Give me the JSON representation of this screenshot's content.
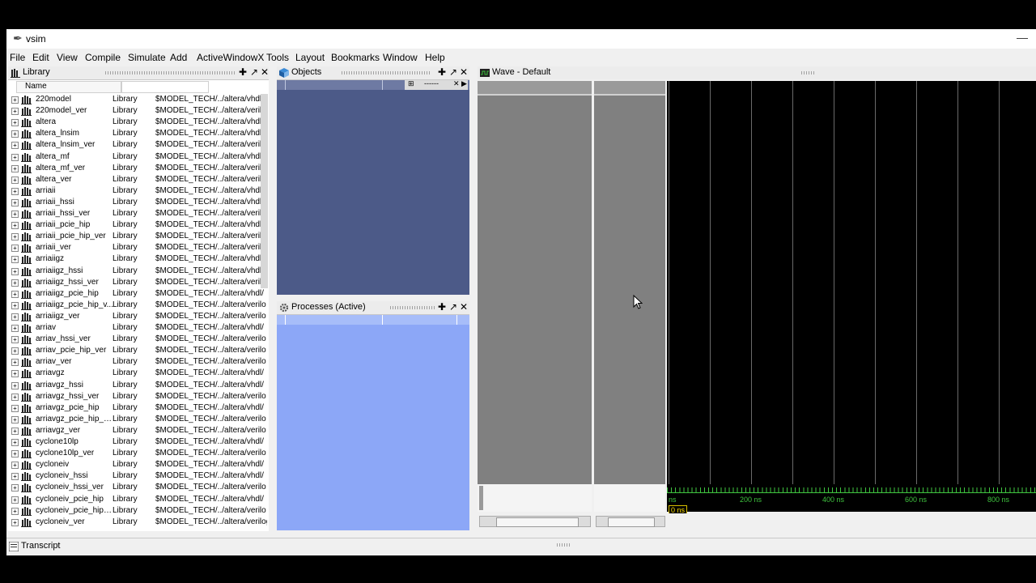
{
  "window": {
    "title": "vsim"
  },
  "menu": [
    "File",
    "Edit",
    "View",
    "Compile",
    "Simulate",
    "Add",
    "ActiveWindowX",
    "Tools",
    "Layout",
    "Bookmarks",
    "Window",
    "Help"
  ],
  "library": {
    "title": "Library",
    "column_name": "Name",
    "rows": [
      {
        "name": "220model",
        "type": "Library",
        "path": "$MODEL_TECH/../altera/vhdl/"
      },
      {
        "name": "220model_ver",
        "type": "Library",
        "path": "$MODEL_TECH/../altera/verilo"
      },
      {
        "name": "altera",
        "type": "Library",
        "path": "$MODEL_TECH/../altera/vhdl/"
      },
      {
        "name": "altera_lnsim",
        "type": "Library",
        "path": "$MODEL_TECH/../altera/vhdl/"
      },
      {
        "name": "altera_lnsim_ver",
        "type": "Library",
        "path": "$MODEL_TECH/../altera/verilo"
      },
      {
        "name": "altera_mf",
        "type": "Library",
        "path": "$MODEL_TECH/../altera/vhdl/"
      },
      {
        "name": "altera_mf_ver",
        "type": "Library",
        "path": "$MODEL_TECH/../altera/verilo"
      },
      {
        "name": "altera_ver",
        "type": "Library",
        "path": "$MODEL_TECH/../altera/verilo"
      },
      {
        "name": "arriaii",
        "type": "Library",
        "path": "$MODEL_TECH/../altera/vhdl/"
      },
      {
        "name": "arriaii_hssi",
        "type": "Library",
        "path": "$MODEL_TECH/../altera/vhdl/"
      },
      {
        "name": "arriaii_hssi_ver",
        "type": "Library",
        "path": "$MODEL_TECH/../altera/verilo"
      },
      {
        "name": "arriaii_pcie_hip",
        "type": "Library",
        "path": "$MODEL_TECH/../altera/vhdl/"
      },
      {
        "name": "arriaii_pcie_hip_ver",
        "type": "Library",
        "path": "$MODEL_TECH/../altera/verilo"
      },
      {
        "name": "arriaii_ver",
        "type": "Library",
        "path": "$MODEL_TECH/../altera/verilo"
      },
      {
        "name": "arriaiigz",
        "type": "Library",
        "path": "$MODEL_TECH/../altera/vhdl/"
      },
      {
        "name": "arriaiigz_hssi",
        "type": "Library",
        "path": "$MODEL_TECH/../altera/vhdl/"
      },
      {
        "name": "arriaiigz_hssi_ver",
        "type": "Library",
        "path": "$MODEL_TECH/../altera/verilo"
      },
      {
        "name": "arriaiigz_pcie_hip",
        "type": "Library",
        "path": "$MODEL_TECH/../altera/vhdl/"
      },
      {
        "name": "arriaiigz_pcie_hip_v...",
        "type": "Library",
        "path": "$MODEL_TECH/../altera/verilo"
      },
      {
        "name": "arriaiigz_ver",
        "type": "Library",
        "path": "$MODEL_TECH/../altera/verilo"
      },
      {
        "name": "arriav",
        "type": "Library",
        "path": "$MODEL_TECH/../altera/vhdl/"
      },
      {
        "name": "arriav_hssi_ver",
        "type": "Library",
        "path": "$MODEL_TECH/../altera/verilo"
      },
      {
        "name": "arriav_pcie_hip_ver",
        "type": "Library",
        "path": "$MODEL_TECH/../altera/verilo"
      },
      {
        "name": "arriav_ver",
        "type": "Library",
        "path": "$MODEL_TECH/../altera/verilo"
      },
      {
        "name": "arriavgz",
        "type": "Library",
        "path": "$MODEL_TECH/../altera/vhdl/"
      },
      {
        "name": "arriavgz_hssi",
        "type": "Library",
        "path": "$MODEL_TECH/../altera/vhdl/"
      },
      {
        "name": "arriavgz_hssi_ver",
        "type": "Library",
        "path": "$MODEL_TECH/../altera/verilo"
      },
      {
        "name": "arriavgz_pcie_hip",
        "type": "Library",
        "path": "$MODEL_TECH/../altera/vhdl/"
      },
      {
        "name": "arriavgz_pcie_hip_v...",
        "type": "Library",
        "path": "$MODEL_TECH/../altera/verilo"
      },
      {
        "name": "arriavgz_ver",
        "type": "Library",
        "path": "$MODEL_TECH/../altera/verilo"
      },
      {
        "name": "cyclone10lp",
        "type": "Library",
        "path": "$MODEL_TECH/../altera/vhdl/"
      },
      {
        "name": "cyclone10lp_ver",
        "type": "Library",
        "path": "$MODEL_TECH/../altera/verilo"
      },
      {
        "name": "cycloneiv",
        "type": "Library",
        "path": "$MODEL_TECH/../altera/vhdl/"
      },
      {
        "name": "cycloneiv_hssi",
        "type": "Library",
        "path": "$MODEL_TECH/../altera/vhdl/"
      },
      {
        "name": "cycloneiv_hssi_ver",
        "type": "Library",
        "path": "$MODEL_TECH/../altera/verilo"
      },
      {
        "name": "cycloneiv_pcie_hip",
        "type": "Library",
        "path": "$MODEL_TECH/../altera/vhdl/"
      },
      {
        "name": "cycloneiv_pcie_hip_...",
        "type": "Library",
        "path": "$MODEL_TECH/../altera/verilo"
      },
      {
        "name": "cycloneiv_ver",
        "type": "Library",
        "path": "$MODEL_TECH/../altera/verilog/"
      }
    ]
  },
  "objects": {
    "title": "Objects",
    "filter_text": "------"
  },
  "processes": {
    "title": "Processes (Active)"
  },
  "wave": {
    "title": "Wave - Default",
    "timeline_ticks": [
      {
        "label": "ns",
        "t": 0
      },
      {
        "label": "200 ns",
        "t": 200
      },
      {
        "label": "400 ns",
        "t": 400
      },
      {
        "label": "600 ns",
        "t": 600
      },
      {
        "label": "800 ns",
        "t": 800
      }
    ],
    "cursor_label": "0 ns"
  },
  "transcript": {
    "title": "Transcript"
  },
  "colors": {
    "objects_bg": "#4c5a88",
    "processes_bg": "#8ca7f7",
    "wave_bg": "#000000",
    "timeline_text": "#3fc33f",
    "cursor_color": "#ffe000"
  }
}
